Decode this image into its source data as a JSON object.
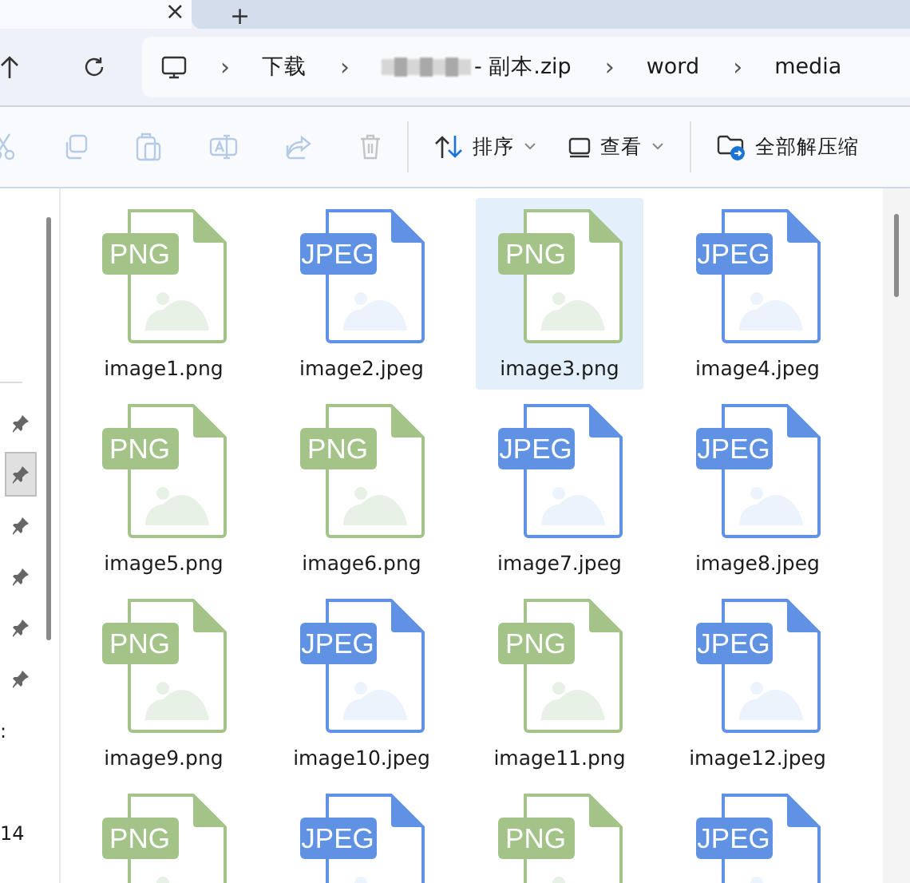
{
  "tabs": {
    "close": "×",
    "new": "+"
  },
  "address": {
    "crumbs": [
      {
        "label": "下载",
        "kind": "text"
      },
      {
        "label": "- 副本.zip",
        "kind": "masked"
      },
      {
        "label": "word",
        "kind": "text"
      },
      {
        "label": "media",
        "kind": "text"
      }
    ],
    "separator": "›"
  },
  "toolbar": {
    "actions": [
      {
        "kind": "cut",
        "disabled": true
      },
      {
        "kind": "copy",
        "disabled": true
      },
      {
        "kind": "paste",
        "disabled": true
      },
      {
        "kind": "rename",
        "disabled": true
      },
      {
        "kind": "share",
        "disabled": true
      },
      {
        "kind": "delete",
        "disabled": true
      }
    ],
    "sort": {
      "label": "排序"
    },
    "view": {
      "label": "查看"
    },
    "extract": {
      "label": "全部解压缩"
    }
  },
  "sidebar": {
    "items": [
      {
        "selected": false
      },
      {
        "selected": true
      },
      {
        "selected": false
      },
      {
        "selected": false
      },
      {
        "selected": false
      },
      {
        "selected": false
      }
    ],
    "fragments": [
      ":",
      "14"
    ]
  },
  "files": [
    {
      "name": "image1.png",
      "kind": "png",
      "badge": "PNG",
      "selected": false
    },
    {
      "name": "image2.jpeg",
      "kind": "jpeg",
      "badge": "JPEG",
      "selected": false
    },
    {
      "name": "image3.png",
      "kind": "png",
      "badge": "PNG",
      "selected": true
    },
    {
      "name": "image4.jpeg",
      "kind": "jpeg",
      "badge": "JPEG",
      "selected": false
    },
    {
      "name": "image5.png",
      "kind": "png",
      "badge": "PNG",
      "selected": false
    },
    {
      "name": "image6.png",
      "kind": "png",
      "badge": "PNG",
      "selected": false
    },
    {
      "name": "image7.jpeg",
      "kind": "jpeg",
      "badge": "JPEG",
      "selected": false
    },
    {
      "name": "image8.jpeg",
      "kind": "jpeg",
      "badge": "JPEG",
      "selected": false
    },
    {
      "name": "image9.png",
      "kind": "png",
      "badge": "PNG",
      "selected": false
    },
    {
      "name": "image10.jpeg",
      "kind": "jpeg",
      "badge": "JPEG",
      "selected": false
    },
    {
      "name": "image11.png",
      "kind": "png",
      "badge": "PNG",
      "selected": false
    },
    {
      "name": "image12.jpeg",
      "kind": "jpeg",
      "badge": "JPEG",
      "selected": false
    },
    {
      "kind": "png",
      "badge": "PNG",
      "selected": false
    },
    {
      "kind": "jpeg",
      "badge": "JPEG",
      "selected": false
    },
    {
      "kind": "png",
      "badge": "PNG",
      "selected": false
    },
    {
      "kind": "jpeg",
      "badge": "JPEG",
      "selected": false
    }
  ]
}
